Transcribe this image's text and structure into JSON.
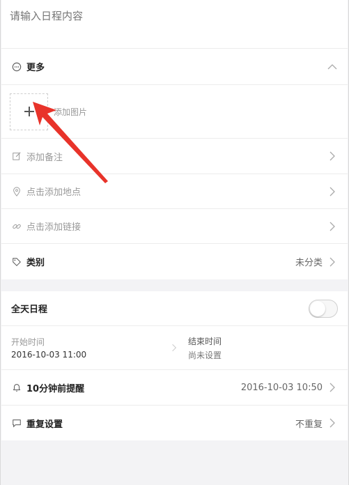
{
  "title_input": {
    "placeholder": "请输入日程内容"
  },
  "more": {
    "label": "更多"
  },
  "image": {
    "add_label": "添加图片"
  },
  "items": [
    {
      "label": "添加备注"
    },
    {
      "label": "点击添加地点"
    },
    {
      "label": "点击添加链接"
    }
  ],
  "category": {
    "label": "类别",
    "value": "未分类"
  },
  "all_day": {
    "label": "全天日程",
    "enabled": false
  },
  "time": {
    "start_label": "开始时间",
    "start_value": "2016-10-03 11:00",
    "end_label": "结束时间",
    "end_value": "尚未设置"
  },
  "reminder": {
    "label": "10分钟前提醒",
    "value": "2016-10-03 10:50"
  },
  "repeat": {
    "label": "重复设置",
    "value": "不重复"
  },
  "colors": {
    "accent_arrow": "#e8332a",
    "divider": "#ececec",
    "background": "#f3f3f5"
  }
}
